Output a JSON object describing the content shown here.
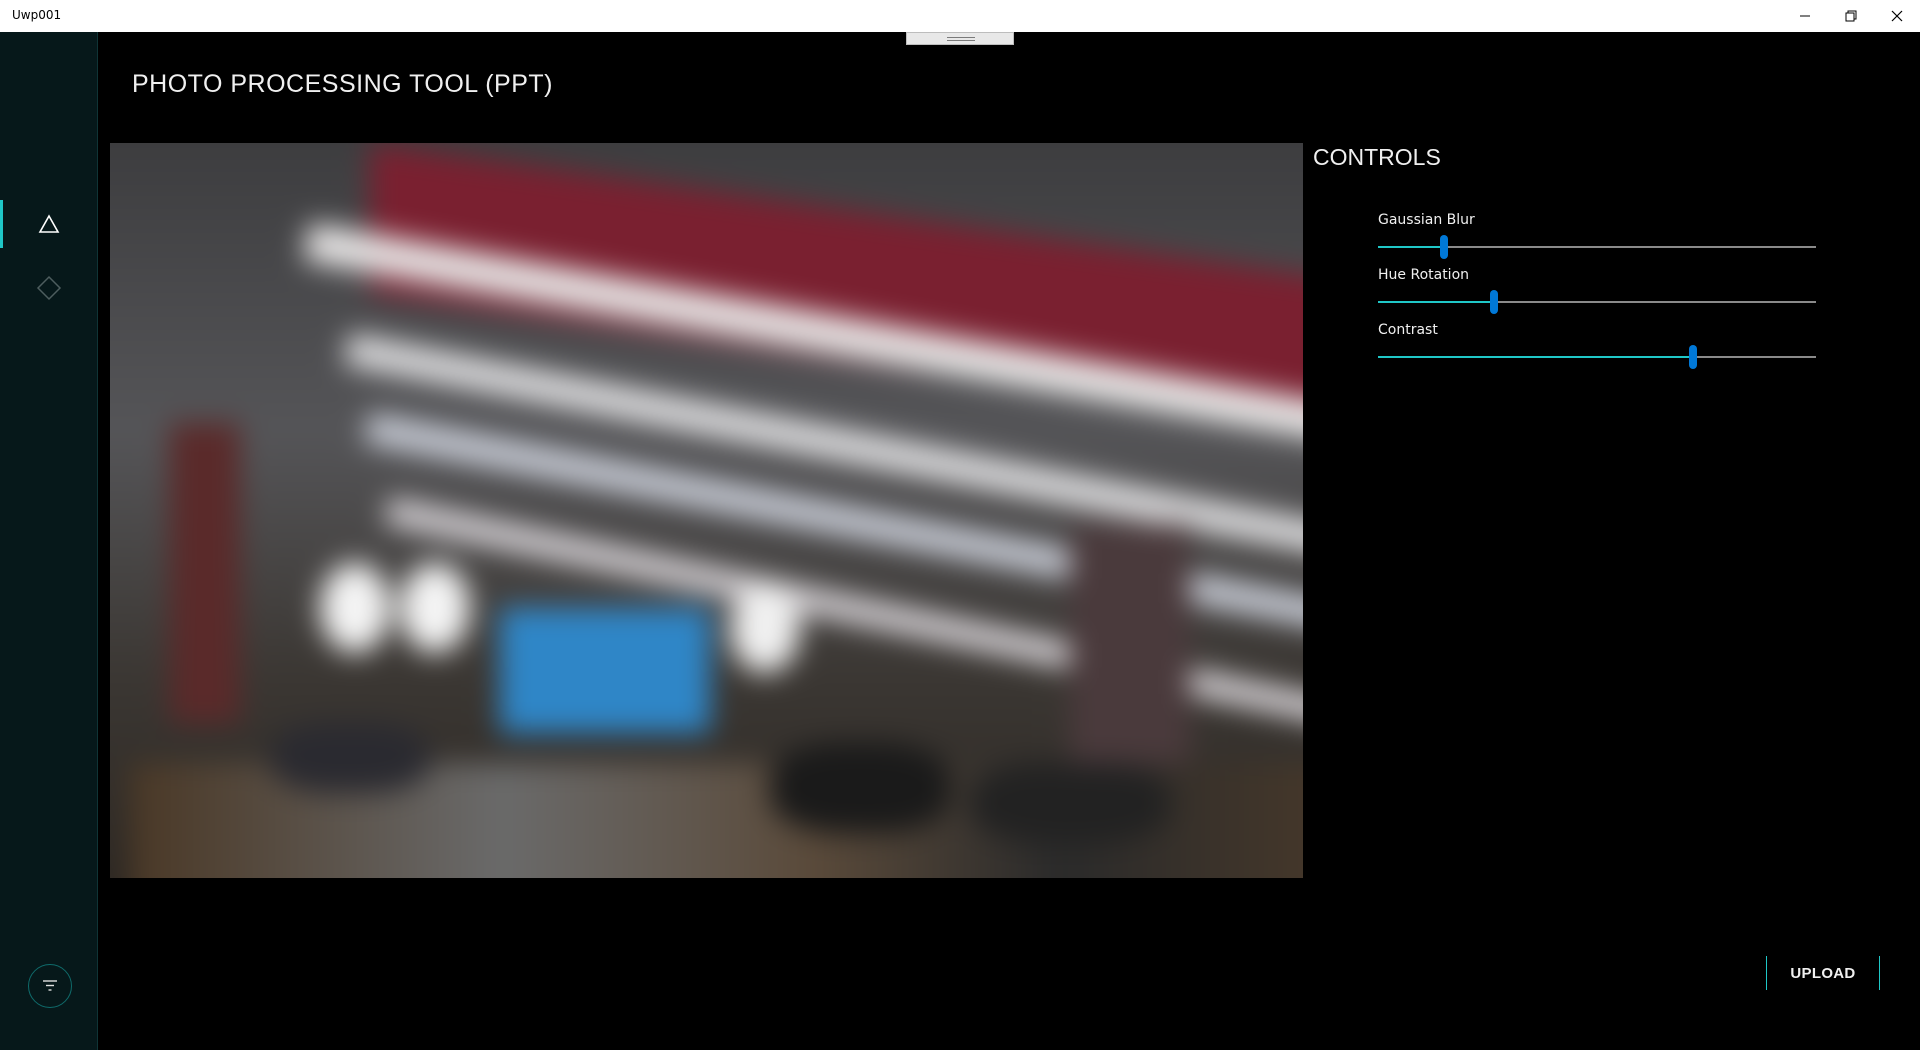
{
  "window": {
    "title": "Uwp001",
    "buttons": [
      "minimize-icon",
      "restore-icon",
      "close-icon"
    ]
  },
  "nav": {
    "items": [
      {
        "icon": "triangle-icon",
        "active": true
      },
      {
        "icon": "diamond-icon",
        "active": false
      }
    ],
    "menu_icon": "filter-menu-icon"
  },
  "page": {
    "title": "PHOTO PROCESSING TOOL (PPT)"
  },
  "controls": {
    "title": "CONTROLS",
    "sliders": [
      {
        "label": "Gaussian Blur",
        "value": 0.15
      },
      {
        "label": "Hue Rotation",
        "value": 0.265
      },
      {
        "label": "Contrast",
        "value": 0.72
      }
    ]
  },
  "actions": {
    "upload_label": "UPLOAD"
  },
  "colors": {
    "accent": "#1fc7c7",
    "slider_thumb": "#0078d7",
    "nav_bg": "#06181a",
    "background": "#000000"
  }
}
